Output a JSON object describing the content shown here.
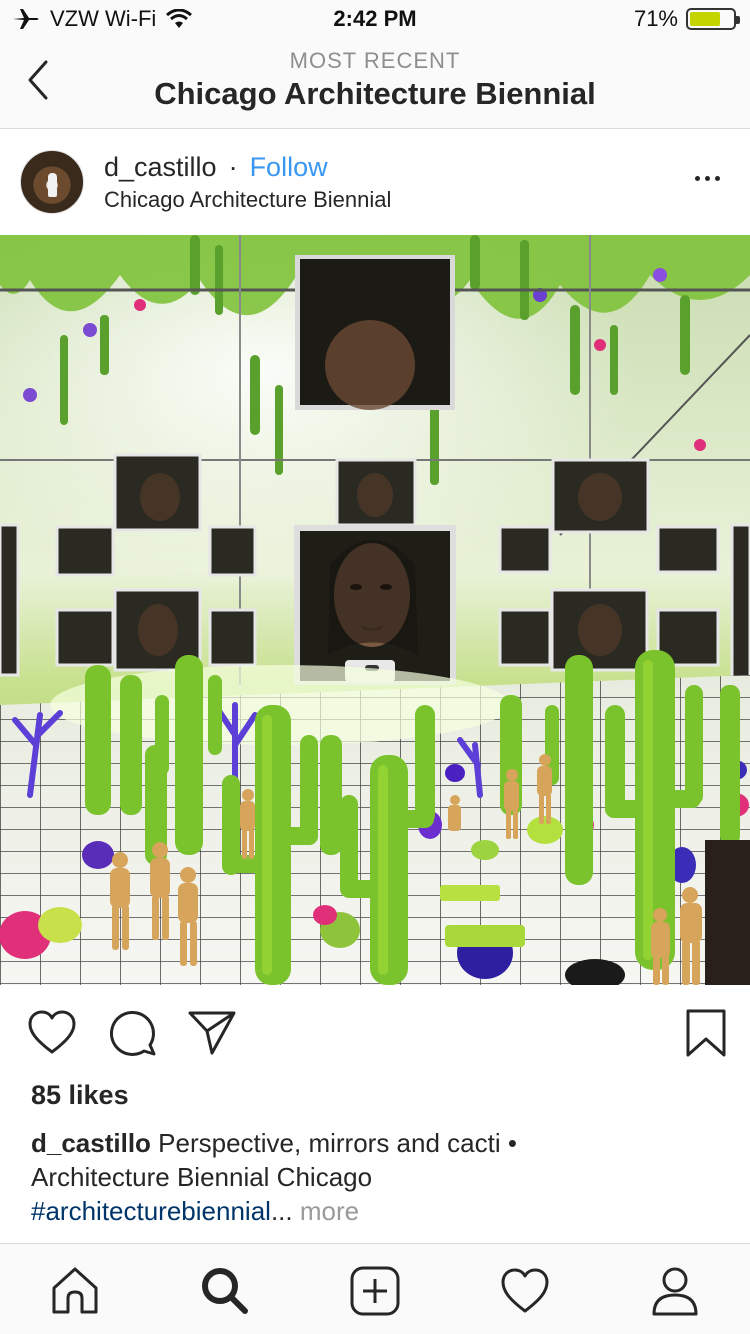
{
  "status_bar": {
    "carrier": "VZW Wi-Fi",
    "time": "2:42 PM",
    "battery_text": "71%",
    "battery_level": 0.71,
    "battery_color": "#c3d400"
  },
  "header": {
    "subtitle": "MOST RECENT",
    "title": "Chicago Architecture Biennial",
    "back_icon": "chevron-left-icon"
  },
  "post": {
    "username": "d_castillo",
    "separator": "·",
    "follow_label": "Follow",
    "location": "Chicago Architecture Biennial",
    "more_icon": "ellipsis-icon",
    "likes": "85 likes",
    "caption": {
      "username": "d_castillo",
      "text_line1": " Perspective, mirrors and cacti •",
      "text_line2": "Architecture Biennial Chicago",
      "hashtag": "#architecturebiennial",
      "ellipsis": "...",
      "more": " more"
    }
  },
  "actions": {
    "like_icon": "heart-icon",
    "comment_icon": "comment-icon",
    "share_icon": "paper-plane-icon",
    "save_icon": "bookmark-icon"
  },
  "tab_bar": {
    "items": [
      "home-icon",
      "search-icon",
      "add-post-icon",
      "activity-heart-icon",
      "profile-icon"
    ]
  },
  "colors": {
    "link_blue": "#3897f0",
    "hashtag_blue": "#003569",
    "divider": "#dbdbdb",
    "muted": "#8e8e8e"
  }
}
